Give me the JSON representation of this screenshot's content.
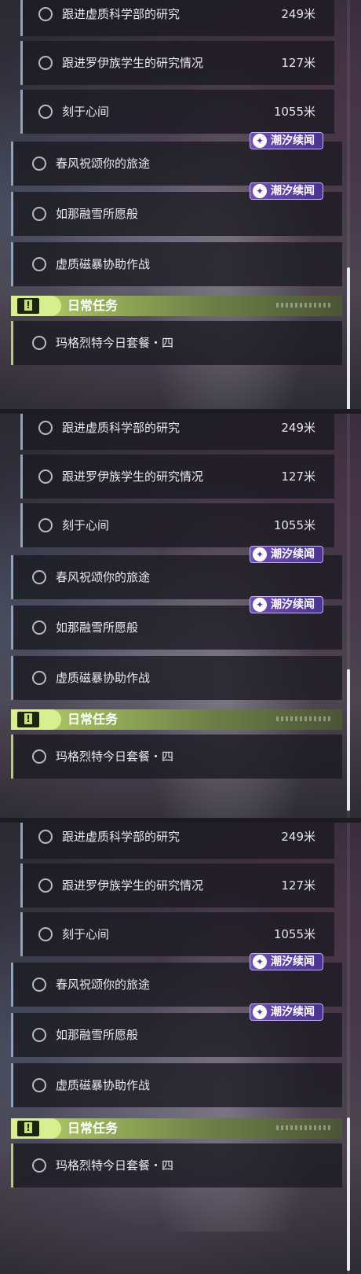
{
  "quests": {
    "q1": {
      "title": "跟进虚质科学部的研究",
      "distance": "249米"
    },
    "q2": {
      "title": "跟进罗伊族学生的研究情况",
      "distance": "127米"
    },
    "q3": {
      "title": "刻于心间",
      "distance": "1055米"
    },
    "q4": {
      "title": "春风祝颂你的旅途",
      "badge": "潮汐续闻"
    },
    "q5": {
      "title": "如那融雪所愿般",
      "badge": "潮汐续闻"
    },
    "q6": {
      "title": "虚质磁暴协助作战"
    }
  },
  "daily": {
    "header_icon": "!",
    "title": "日常任务",
    "quest": "玛格烈特今日套餐・四"
  },
  "badge_icon": "✦",
  "colors": {
    "sub_quest_bar": "#8fa3b8",
    "daily_accent": "#b9d36d",
    "badge_bg": "#6f4fb3"
  }
}
